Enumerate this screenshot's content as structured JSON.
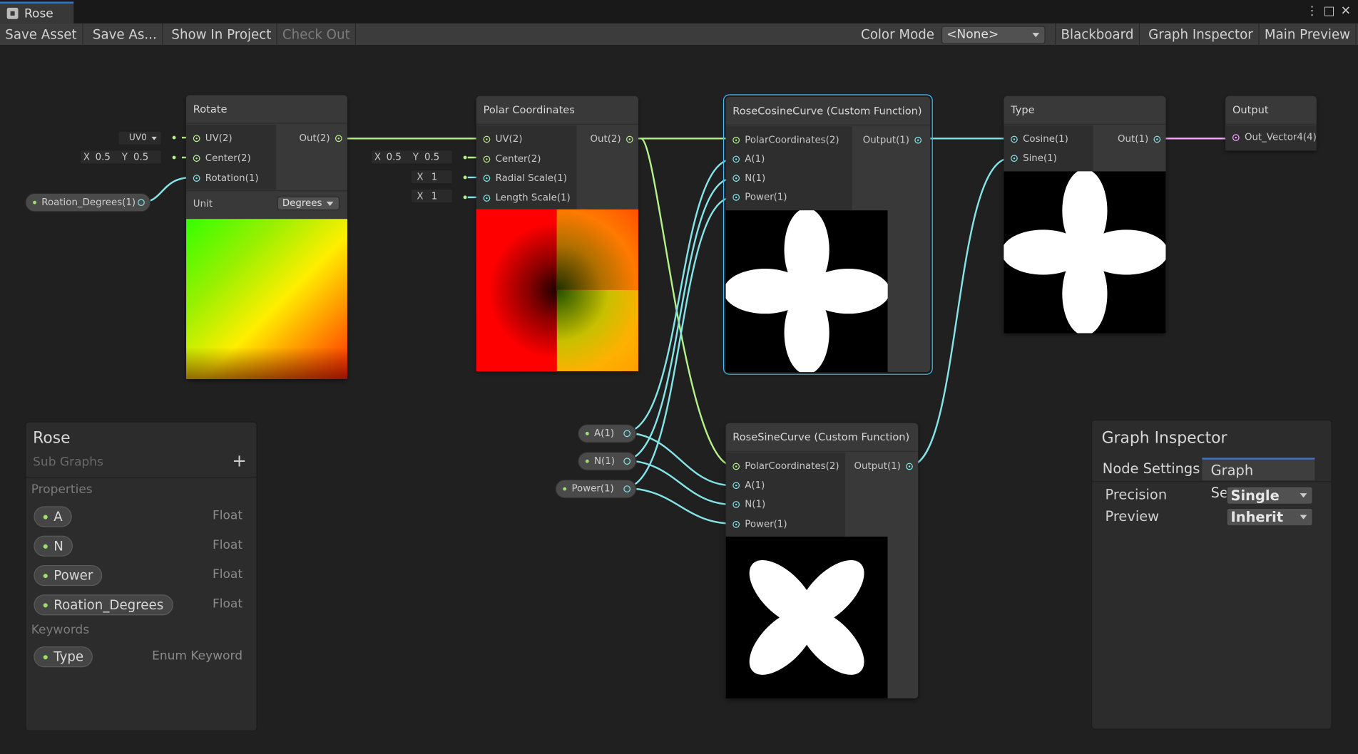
{
  "window": {
    "tab_title": "Rose"
  },
  "toolbar": {
    "save_asset": "Save Asset",
    "save_as": "Save As...",
    "show_in_project": "Show In Project",
    "check_out": "Check Out",
    "color_mode_label": "Color Mode",
    "color_mode_value": "<None>",
    "blackboard": "Blackboard",
    "graph_inspector": "Graph Inspector",
    "main_preview": "Main Preview"
  },
  "nodes": {
    "rotate": {
      "title": "Rotate",
      "inputs": [
        "UV(2)",
        "Center(2)",
        "Rotation(1)"
      ],
      "output": "Out(2)",
      "unit_label": "Unit",
      "unit_value": "Degrees",
      "uv_channel": "UV0",
      "center_x_label": "X",
      "center_x": "0.5",
      "center_y_label": "Y",
      "center_y": "0.5"
    },
    "polar": {
      "title": "Polar Coordinates",
      "inputs": [
        "UV(2)",
        "Center(2)",
        "Radial Scale(1)",
        "Length Scale(1)"
      ],
      "output": "Out(2)",
      "center_x_label": "X",
      "center_x": "0.5",
      "center_y_label": "Y",
      "center_y": "0.5",
      "radial_label": "X",
      "radial": "1",
      "length_label": "X",
      "length": "1"
    },
    "rose_cos": {
      "title": "RoseCosineCurve (Custom Function)",
      "inputs": [
        "PolarCoordinates(2)",
        "A(1)",
        "N(1)",
        "Power(1)"
      ],
      "output": "Output(1)"
    },
    "rose_sin": {
      "title": "RoseSineCurve (Custom Function)",
      "inputs": [
        "PolarCoordinates(2)",
        "A(1)",
        "N(1)",
        "Power(1)"
      ],
      "output": "Output(1)"
    },
    "type": {
      "title": "Type",
      "inputs": [
        "Cosine(1)",
        "Sine(1)"
      ],
      "output": "Out(1)"
    },
    "output": {
      "title": "Output",
      "inputs": [
        "Out_Vector4(4)"
      ]
    }
  },
  "property_nodes": {
    "rotation_degrees": "Roation_Degrees(1)",
    "a": "A(1)",
    "n": "N(1)",
    "power": "Power(1)"
  },
  "blackboard": {
    "title": "Rose",
    "subtitle": "Sub Graphs",
    "add_icon": "+",
    "properties_header": "Properties",
    "properties": [
      {
        "name": "A",
        "type": "Float"
      },
      {
        "name": "N",
        "type": "Float"
      },
      {
        "name": "Power",
        "type": "Float"
      },
      {
        "name": "Roation_Degrees",
        "type": "Float"
      }
    ],
    "keywords_header": "Keywords",
    "keywords": [
      {
        "name": "Type",
        "type": "Enum Keyword"
      }
    ]
  },
  "graph_inspector": {
    "title": "Graph Inspector",
    "tabs": [
      "Node Settings",
      "Graph Settings"
    ],
    "active_tab": "Graph Settings",
    "precision_label": "Precision",
    "precision_value": "Single",
    "preview_label": "Preview",
    "preview_value": "Inherit"
  },
  "colors": {
    "vector2_wire": "#b6f08a",
    "float_wire": "#84e4e7",
    "vector4_wire": "#f9a6ff",
    "selection": "#44c0ff",
    "tab_accent": "#3a79bb"
  }
}
